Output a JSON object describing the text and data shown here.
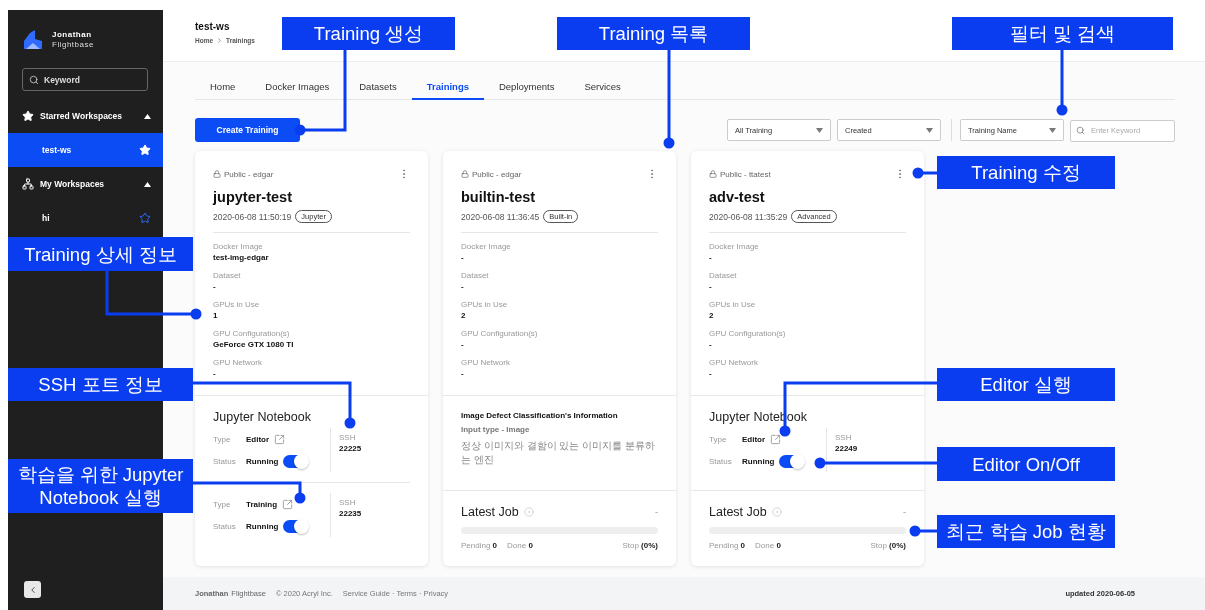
{
  "sidebar": {
    "brand": [
      "Jonathan",
      "Flightbase"
    ],
    "search": {
      "placeholder": "Keyword"
    },
    "groups": [
      {
        "kind": "starred",
        "title": "Starred Workspaces",
        "expanded": true,
        "items": [
          {
            "label": "test-ws",
            "selected": true,
            "starred": true
          }
        ]
      },
      {
        "kind": "workspaces",
        "title": "My Workspaces",
        "expanded": true,
        "items": [
          {
            "label": "hi",
            "selected": false,
            "starred": false
          }
        ]
      }
    ]
  },
  "header": {
    "title": "test-ws",
    "breadcrumb": [
      "Home",
      "Trainings"
    ]
  },
  "tabs": [
    {
      "label": "Home",
      "selected": false
    },
    {
      "label": "Docker Images",
      "selected": false
    },
    {
      "label": "Datasets",
      "selected": false
    },
    {
      "label": "Trainings",
      "selected": true
    },
    {
      "label": "Deployments",
      "selected": false
    },
    {
      "label": "Services",
      "selected": false
    }
  ],
  "create_button": "Create Training",
  "filters": [
    {
      "kind": "select",
      "value": "All Training"
    },
    {
      "kind": "select",
      "value": "Created"
    },
    {
      "kind": "select",
      "value": "Training Name"
    },
    {
      "kind": "search",
      "placeholder": "Enter Keyword"
    }
  ],
  "cards": [
    {
      "visibility": "Public - edgar",
      "title": "jupyter-test",
      "created": "2020-06-08 11:50:19",
      "badge": "Jupyter",
      "fields": [
        {
          "label": "Docker Image",
          "value": "test-img-edgar"
        },
        {
          "label": "Dataset",
          "value": "-"
        },
        {
          "label": "GPUs in Use",
          "value": "1"
        },
        {
          "label": "GPU Configuration(s)",
          "value": "GeForce GTX 1080 TI"
        },
        {
          "label": "GPU Network",
          "value": "-"
        }
      ],
      "sections": [
        {
          "kind": "notebook",
          "title": "Jupyter Notebook",
          "instances": [
            {
              "type_label": "Type",
              "type": "Editor",
              "status_label": "Status",
              "status": "Running",
              "on": true,
              "ssh_label": "SSH",
              "ssh": "22225"
            },
            {
              "type_label": "Type",
              "type": "Training",
              "status_label": "Status",
              "status": "Running",
              "on": true,
              "ssh_label": "SSH",
              "ssh": "22235"
            }
          ]
        }
      ]
    },
    {
      "visibility": "Public - edgar",
      "title": "builtin-test",
      "created": "2020-06-08 11:36:45",
      "badge": "Built-in",
      "fields": [
        {
          "label": "Docker Image",
          "value": "-"
        },
        {
          "label": "Dataset",
          "value": "-"
        },
        {
          "label": "GPUs in Use",
          "value": "2"
        },
        {
          "label": "GPU Configuration(s)",
          "value": "-"
        },
        {
          "label": "GPU Network",
          "value": "-"
        }
      ],
      "sections": [
        {
          "kind": "info",
          "title": "Image Defect Classification's Information",
          "subtitle": "Input type - Image",
          "description": "정상 이미지와 결함이 있는 이미지를 분류하는 엔진"
        },
        {
          "kind": "latest_job",
          "title": "Latest Job",
          "value": "-",
          "level": 0,
          "pending_label": "Pending",
          "pending": "0",
          "done_label": "Done",
          "done": "0",
          "stop_label": "Stop",
          "stop": "(0%)"
        }
      ]
    },
    {
      "visibility": "Public - ttatest",
      "title": "adv-test",
      "created": "2020-06-08 11:35:29",
      "badge": "Advanced",
      "fields": [
        {
          "label": "Docker Image",
          "value": "-"
        },
        {
          "label": "Dataset",
          "value": "-"
        },
        {
          "label": "GPUs in Use",
          "value": "2"
        },
        {
          "label": "GPU Configuration(s)",
          "value": "-"
        },
        {
          "label": "GPU Network",
          "value": "-"
        }
      ],
      "sections": [
        {
          "kind": "notebook",
          "title": "Jupyter Notebook",
          "instances": [
            {
              "type_label": "Type",
              "type": "Editor",
              "status_label": "Status",
              "status": "Running",
              "on": true,
              "ssh_label": "SSH",
              "ssh": "22249"
            }
          ]
        },
        {
          "kind": "latest_job",
          "title": "Latest Job",
          "value": "-",
          "level": 0,
          "pending_label": "Pending",
          "pending": "0",
          "done_label": "Done",
          "done": "0",
          "stop_label": "Stop",
          "stop": "(0%)"
        }
      ]
    }
  ],
  "footer": {
    "brand": [
      "Jonathan",
      "Flightbase"
    ],
    "copyright": "© 2020 Acryl Inc.",
    "links": "Service Guide · Terms · Privacy",
    "updated": "updated 2020-06-05"
  },
  "annotations": [
    {
      "text": "Training 생성"
    },
    {
      "text": "Training 목록"
    },
    {
      "text": "필터 및 검색"
    },
    {
      "text": "Training 수정"
    },
    {
      "text": "Training 상세 정보"
    },
    {
      "text": "SSH 포트 정보"
    },
    {
      "text": "학습을 위한 Jupyter Notebook 실행"
    },
    {
      "text": "Editor 실행"
    },
    {
      "text": "Editor On/Off"
    },
    {
      "text": "최근 학습 Job 현황"
    }
  ]
}
